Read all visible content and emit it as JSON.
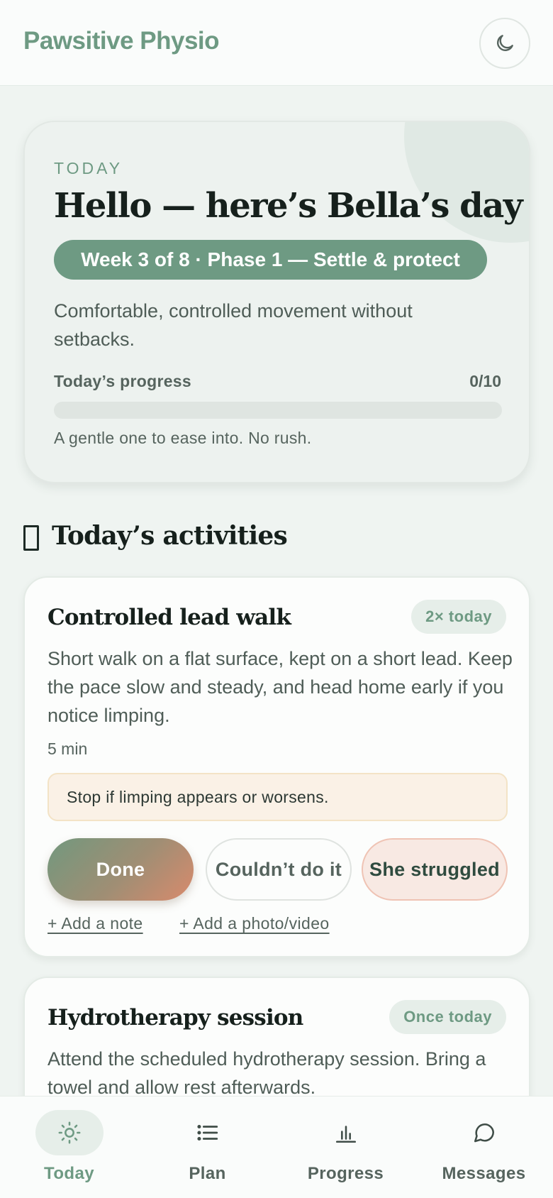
{
  "app": {
    "title": "Pawsitive Physio"
  },
  "hero": {
    "eyebrow": "TODAY",
    "title": "Hello — here’s Bella’s day",
    "phase": "Week 3 of 8 · Phase 1 — Settle & protect",
    "description": "Comfortable, controlled movement without setbacks.",
    "progress_label": "Today’s progress",
    "progress_count": "0/10",
    "progress_fraction": 0,
    "progress_note": "A gentle one to ease into. No rush."
  },
  "activities_section": {
    "title": "Today’s activities"
  },
  "activities": [
    {
      "title": "Controlled lead walk",
      "frequency": "2× today",
      "description": "Short walk on a flat surface, kept on a short lead. Keep the pace slow and steady, and head home early if you notice limping.",
      "duration": "5 min",
      "warning": "Stop if limping appears or worsens.",
      "done_label": "Done",
      "couldnt_label": "Couldn’t do it",
      "struggled_label": "She struggled",
      "add_note_label": "+ Add a note",
      "add_media_label": "+ Add a photo/video"
    },
    {
      "title": "Hydrotherapy session",
      "frequency": "Once today",
      "description": "Attend the scheduled hydrotherapy session. Bring a towel and allow rest afterwards."
    }
  ],
  "nav": {
    "today": "Today",
    "plan": "Plan",
    "progress": "Progress",
    "messages": "Messages"
  },
  "colors": {
    "accent": "#6e9a83",
    "background": "#eff4f1",
    "warning_bg": "#faf1e6",
    "struggled_bg": "#f8e9e3"
  }
}
